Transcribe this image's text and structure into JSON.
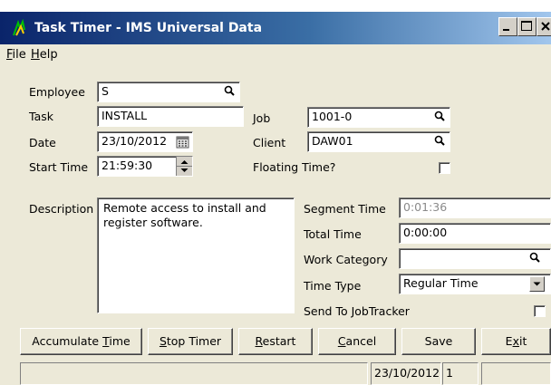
{
  "window": {
    "title": "Task Timer - IMS Universal Data"
  },
  "menu": [
    {
      "prefix": "",
      "key": "F",
      "rest": "ile"
    },
    {
      "prefix": "",
      "key": "H",
      "rest": "elp"
    }
  ],
  "form": {
    "employee": {
      "label": "Employee",
      "value": "S"
    },
    "task": {
      "label": "Task",
      "value": "INSTALL"
    },
    "job": {
      "label": "Job",
      "value": "1001-0"
    },
    "date": {
      "label": "Date",
      "value": "23/10/2012"
    },
    "client": {
      "label": "Client",
      "value": "DAW01"
    },
    "start_time": {
      "label": "Start Time",
      "value": "21:59:30"
    },
    "floating_time": {
      "label": "Floating Time?",
      "checked": false
    },
    "description": {
      "label": "Description",
      "value": "Remote access to install and register software."
    },
    "segment_time": {
      "label": "Segment Time",
      "value": "0:01:36"
    },
    "total_time": {
      "label": "Total Time",
      "value": "0:00:00"
    },
    "work_category": {
      "label": "Work Category",
      "value": ""
    },
    "time_type": {
      "label": "Time Type",
      "value": "Regular Time"
    },
    "send_to_jobtracker": {
      "label": "Send To JobTracker",
      "checked": false
    }
  },
  "buttons": {
    "accumulate": {
      "prefix": "Accumulate ",
      "key": "T",
      "rest": "ime"
    },
    "stop": {
      "prefix": "",
      "key": "S",
      "rest": "top Timer"
    },
    "restart": {
      "prefix": "",
      "key": "R",
      "rest": "estart"
    },
    "cancel": {
      "prefix": "",
      "key": "C",
      "rest": "ancel"
    },
    "save": {
      "label": "Save"
    },
    "exit": {
      "prefix": "E",
      "key": "x",
      "rest": "it"
    }
  },
  "status": {
    "panel1": "",
    "date": "23/10/2012",
    "number": "1",
    "panel4": ""
  }
}
